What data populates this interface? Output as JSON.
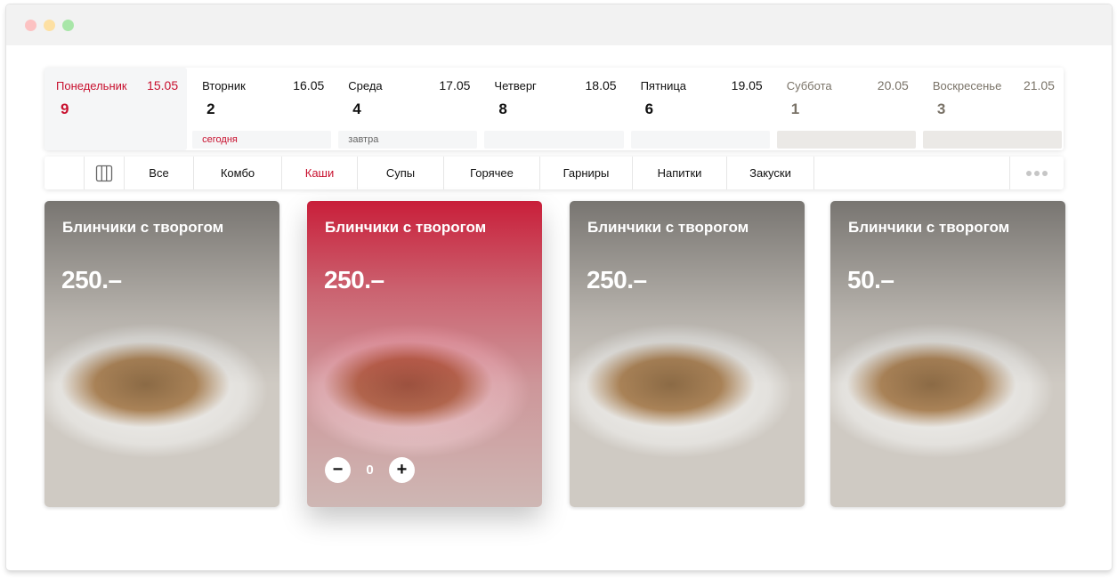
{
  "days": [
    {
      "name": "Понедельник",
      "date": "15.05",
      "count": "9",
      "foot": "",
      "state": "active"
    },
    {
      "name": "Вторник",
      "date": "16.05",
      "count": "2",
      "foot": "сегодня",
      "state": "today"
    },
    {
      "name": "Среда",
      "date": "17.05",
      "count": "4",
      "foot": "завтра",
      "state": "normal"
    },
    {
      "name": "Четверг",
      "date": "18.05",
      "count": "8",
      "foot": "",
      "state": "normal"
    },
    {
      "name": "Пятница",
      "date": "19.05",
      "count": "6",
      "foot": "",
      "state": "normal"
    },
    {
      "name": "Суббота",
      "date": "20.05",
      "count": "1",
      "foot": "",
      "state": "weekend"
    },
    {
      "name": "Воскресенье",
      "date": "21.05",
      "count": "3",
      "foot": "",
      "state": "weekend"
    }
  ],
  "categories": [
    {
      "label": "Все",
      "active": false
    },
    {
      "label": "Комбо",
      "active": false
    },
    {
      "label": "Каши",
      "active": true
    },
    {
      "label": "Супы",
      "active": false
    },
    {
      "label": "Горячее",
      "active": false
    },
    {
      "label": "Гарниры",
      "active": false
    },
    {
      "label": "Напитки",
      "active": false
    },
    {
      "label": "Закуски",
      "active": false
    }
  ],
  "cards": [
    {
      "name": "Блинчики с творогом",
      "price": "250.–",
      "highlight": false
    },
    {
      "name": "Блинчики с творогом",
      "price": "250.–",
      "highlight": true,
      "quantity": "0",
      "minus": "−",
      "plus": "+"
    },
    {
      "name": "Блинчики с творогом",
      "price": "250.–",
      "highlight": false
    },
    {
      "name": "Блинчики с творогом",
      "price": "50.–",
      "highlight": false
    }
  ],
  "icons": {
    "grid_view": "columns-icon",
    "more": "more-dots-icon",
    "minus": "minus-icon",
    "plus": "plus-icon"
  },
  "colors": {
    "accent": "#c8102e",
    "weekend_text": "#7a7368",
    "panel_bg": "#f5f6f7"
  }
}
